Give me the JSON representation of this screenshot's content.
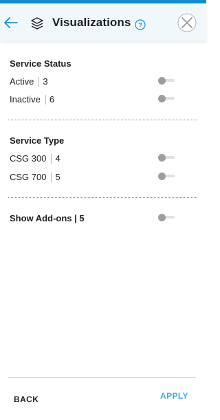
{
  "header": {
    "title": "Visualizations",
    "back_icon": "arrow-left-icon",
    "layers_icon": "layers-icon",
    "help_icon": "question-circle-icon",
    "close_icon": "close-icon"
  },
  "sections": [
    {
      "title": "Service Status",
      "items": [
        {
          "label": "Active",
          "count": "3",
          "enabled": false
        },
        {
          "label": "Inactive",
          "count": "6",
          "enabled": false
        }
      ]
    },
    {
      "title": "Service Type",
      "items": [
        {
          "label": "CSG 300",
          "count": "4",
          "enabled": false
        },
        {
          "label": "CSG 700",
          "count": "5",
          "enabled": false
        }
      ]
    }
  ],
  "addons": {
    "label": "Show Add-ons | 5",
    "enabled": false
  },
  "footer": {
    "back_label": "BACK",
    "apply_label": "APPLY"
  },
  "colors": {
    "accent": "#0f8dd0",
    "apply": "#46a9df",
    "header_bg": "#f1f8fc",
    "toggle_knob_off": "#9e9e9e",
    "toggle_track_off": "#e1e1e1"
  }
}
